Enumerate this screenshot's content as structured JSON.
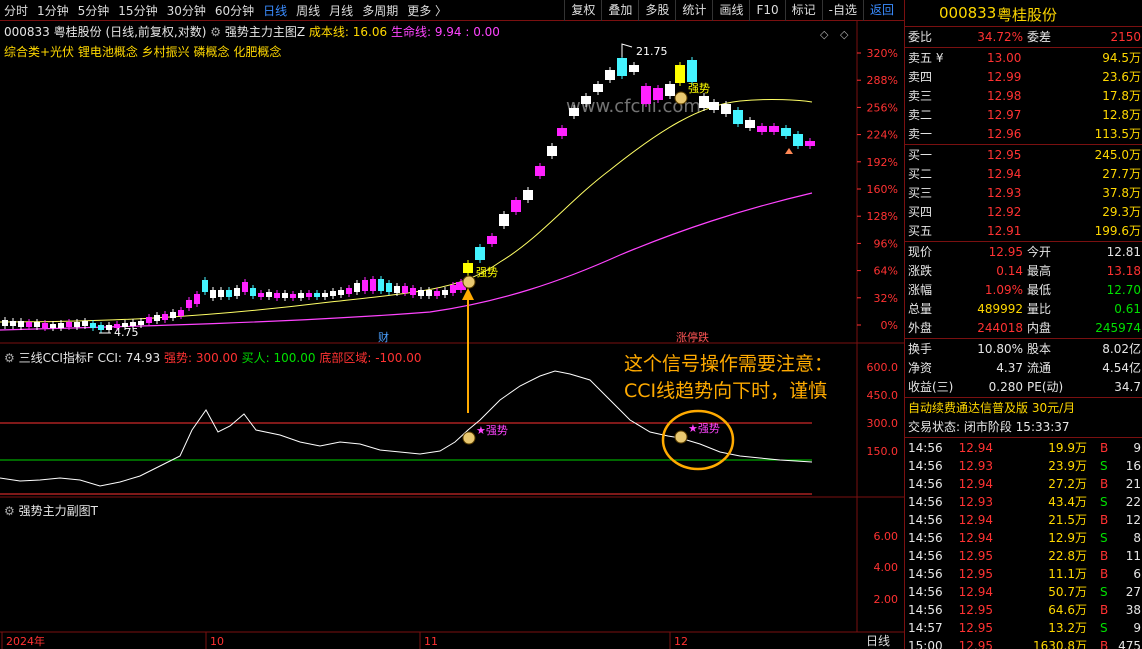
{
  "toolbar": {
    "periods": [
      "分时",
      "1分钟",
      "5分钟",
      "15分钟",
      "30分钟",
      "60分钟",
      "日线",
      "周线",
      "月线",
      "多周期",
      "更多 〉"
    ],
    "active_period": "日线",
    "right": [
      "复权",
      "叠加",
      "多股",
      "统计",
      "画线",
      "F10",
      "标记",
      "-自选",
      "返回"
    ]
  },
  "main": {
    "stock_label": "000833 粤桂股份 (日线,前复权,对数)",
    "indicator": "强势主力主图Z",
    "cost_label": "成本线: 16.06",
    "life_label": "生命线: 9.94 : 0.00",
    "concepts": "综合类+光伏  锂电池概念  乡村振兴  磷概念  化肥概念",
    "yaxis": [
      "320%",
      "288%",
      "256%",
      "224%",
      "192%",
      "160%",
      "128%",
      "96%",
      "64%",
      "32%",
      "0%"
    ],
    "high_label": "21.75",
    "low_label": "4.75",
    "tag_strong": "强势",
    "tag_cai": "财",
    "tag_zhangtie": "涨停跌"
  },
  "cci": {
    "name": "三线CCI指标F",
    "value_label": "CCI: 74.93",
    "strong_label": "强势: 300.00",
    "buy_label": "买人: 100.00",
    "bottom_label": "底部区域: -100.00",
    "yaxis": [
      "600.0",
      "450.0",
      "300.0",
      "150.0"
    ],
    "annotation_line1": "这个信号操作需要注意：",
    "annotation_line2": "CCI线趋势向下时，谨慎",
    "tag_strong": "强势"
  },
  "sub": {
    "name": "强势主力副图T",
    "yaxis": [
      "6.00",
      "4.00",
      "2.00"
    ]
  },
  "xaxis": {
    "labels": [
      "2024年",
      "10",
      "11",
      "12"
    ],
    "period": "日线"
  },
  "watermark": "www.cfchi.com",
  "chart_data": {
    "type": "candlestick",
    "note_series": [
      "price",
      "cost_line",
      "life_line",
      "cci"
    ]
  },
  "quote": {
    "code": "000833",
    "name": "粤桂股份",
    "wb_label": "委比",
    "wb_val": "34.72%",
    "wc_label": "委差",
    "wc_val": "2150",
    "asks": [
      {
        "l": "卖五 ¥",
        "p": "13.00",
        "v": "94.5万"
      },
      {
        "l": "卖四",
        "p": "12.99",
        "v": "23.6万"
      },
      {
        "l": "卖三",
        "p": "12.98",
        "v": "17.8万"
      },
      {
        "l": "卖二",
        "p": "12.97",
        "v": "12.8万"
      },
      {
        "l": "卖一",
        "p": "12.96",
        "v": "113.5万"
      }
    ],
    "bids": [
      {
        "l": "买一",
        "p": "12.95",
        "v": "245.0万"
      },
      {
        "l": "买二",
        "p": "12.94",
        "v": "27.7万"
      },
      {
        "l": "买三",
        "p": "12.93",
        "v": "37.8万"
      },
      {
        "l": "买四",
        "p": "12.92",
        "v": "29.3万"
      },
      {
        "l": "买五",
        "p": "12.91",
        "v": "199.6万"
      }
    ],
    "stats": [
      {
        "a": "现价",
        "b": "12.95",
        "bc": "red",
        "c": "今开",
        "d": "12.81",
        "dc": "wht"
      },
      {
        "a": "涨跌",
        "b": "0.14",
        "bc": "red",
        "c": "最高",
        "d": "13.18",
        "dc": "red"
      },
      {
        "a": "涨幅",
        "b": "1.09%",
        "bc": "red",
        "c": "最低",
        "d": "12.70",
        "dc": "grn"
      },
      {
        "a": "总量",
        "b": "489992",
        "bc": "yel",
        "c": "量比",
        "d": "0.61",
        "dc": "grn"
      },
      {
        "a": "外盘",
        "b": "244018",
        "bc": "red",
        "c": "内盘",
        "d": "245974",
        "dc": "grn"
      }
    ],
    "stats2": [
      {
        "a": "换手",
        "b": "10.80%",
        "c": "股本",
        "d": "8.02亿"
      },
      {
        "a": "净资",
        "b": "4.37",
        "c": "流通",
        "d": "4.54亿"
      },
      {
        "a": "收益(三)",
        "b": "0.280",
        "c": "PE(动)",
        "d": "34.7"
      }
    ],
    "promo": "自动续费通达信普及版  30元/月",
    "status": "交易状态: 闭市阶段 15:33:37",
    "ticks": [
      {
        "t": "14:56",
        "p": "12.94",
        "v": "19.9万",
        "s": "B",
        "n": "9"
      },
      {
        "t": "14:56",
        "p": "12.93",
        "v": "23.9万",
        "s": "S",
        "n": "16"
      },
      {
        "t": "14:56",
        "p": "12.94",
        "v": "27.2万",
        "s": "B",
        "n": "21"
      },
      {
        "t": "14:56",
        "p": "12.93",
        "v": "43.4万",
        "s": "S",
        "n": "22"
      },
      {
        "t": "14:56",
        "p": "12.94",
        "v": "21.5万",
        "s": "B",
        "n": "12"
      },
      {
        "t": "14:56",
        "p": "12.94",
        "v": "12.9万",
        "s": "S",
        "n": "8"
      },
      {
        "t": "14:56",
        "p": "12.95",
        "v": "22.8万",
        "s": "B",
        "n": "11"
      },
      {
        "t": "14:56",
        "p": "12.95",
        "v": "11.1万",
        "s": "B",
        "n": "6"
      },
      {
        "t": "14:56",
        "p": "12.94",
        "v": "50.7万",
        "s": "S",
        "n": "27"
      },
      {
        "t": "14:56",
        "p": "12.95",
        "v": "64.6万",
        "s": "B",
        "n": "38"
      },
      {
        "t": "14:57",
        "p": "12.95",
        "v": "13.2万",
        "s": "S",
        "n": "9"
      },
      {
        "t": "15:00",
        "p": "12.95",
        "v": "1630.8万",
        "s": "B",
        "n": "475"
      }
    ]
  },
  "colors": {
    "up": "#ff3232",
    "down": "#00e000",
    "magenta": "#ff22ff",
    "cyan": "#44f4ff",
    "yellow": "#ffff00",
    "frame": "#7a1010"
  }
}
